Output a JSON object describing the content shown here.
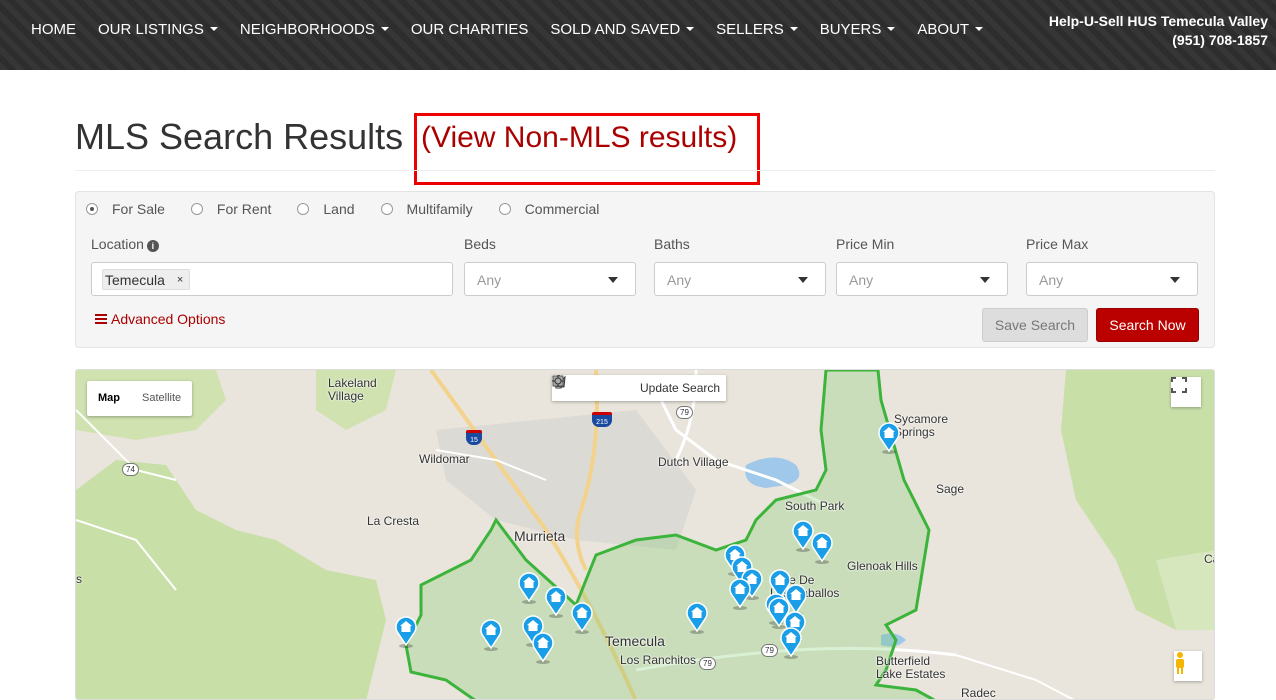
{
  "nav": {
    "items": [
      {
        "label": "HOME",
        "dropdown": false
      },
      {
        "label": "OUR LISTINGS",
        "dropdown": true
      },
      {
        "label": "NEIGHBORHOODS",
        "dropdown": true
      },
      {
        "label": "OUR CHARITIES",
        "dropdown": false
      },
      {
        "label": "SOLD AND SAVED",
        "dropdown": true
      },
      {
        "label": "SELLERS",
        "dropdown": true
      },
      {
        "label": "BUYERS",
        "dropdown": true
      },
      {
        "label": "ABOUT",
        "dropdown": true
      }
    ],
    "brand_name": "Help-U-Sell HUS Temecula Valley",
    "brand_phone": "(951) 708-1857"
  },
  "page": {
    "title": "MLS Search Results",
    "nonmls_link": "(View Non-MLS results)"
  },
  "search": {
    "types": [
      {
        "label": "For Sale",
        "checked": true
      },
      {
        "label": "For Rent",
        "checked": false
      },
      {
        "label": "Land",
        "checked": false
      },
      {
        "label": "Multifamily",
        "checked": false
      },
      {
        "label": "Commercial",
        "checked": false
      }
    ],
    "location_label": "Location",
    "location_chip": "Temecula",
    "chip_remove": "×",
    "beds_label": "Beds",
    "beds_value": "Any",
    "baths_label": "Baths",
    "baths_value": "Any",
    "price_min_label": "Price Min",
    "price_min_value": "Any",
    "price_max_label": "Price Max",
    "price_max_value": "Any",
    "advanced_label": "Advanced Options",
    "save_label": "Save Search",
    "search_label": "Search Now"
  },
  "map": {
    "type_map": "Map",
    "type_satellite": "Satellite",
    "update_label": "Update Search",
    "place_labels": {
      "lakeland": "Lakeland\nVillage",
      "wildomar": "Wildomar",
      "dutch_village": "Dutch Village",
      "la_cresta": "La Cresta",
      "murrieta": "Murrieta",
      "temecula": "Temecula",
      "los_ranchitos": "Los Ranchitos",
      "south_park": "South Park",
      "sycamore": "Sycamore\nSprings",
      "sage": "Sage",
      "glenoak": "Glenoak Hills",
      "valle": "Valle De\nLos Caballos",
      "butterfield": "Butterfield\nLake Estates",
      "radec": "Radec",
      "edge_s": "s",
      "edge_c": "Ca"
    },
    "routes": {
      "r15": "15",
      "r215": "215",
      "r79a": "79",
      "r79b": "79",
      "r79c": "79",
      "r74": "74"
    },
    "listing_pins": 21,
    "colors": {
      "boundary": "#3cb43c",
      "pin": "#1a9ee8",
      "park": "#c9dfa8"
    }
  }
}
